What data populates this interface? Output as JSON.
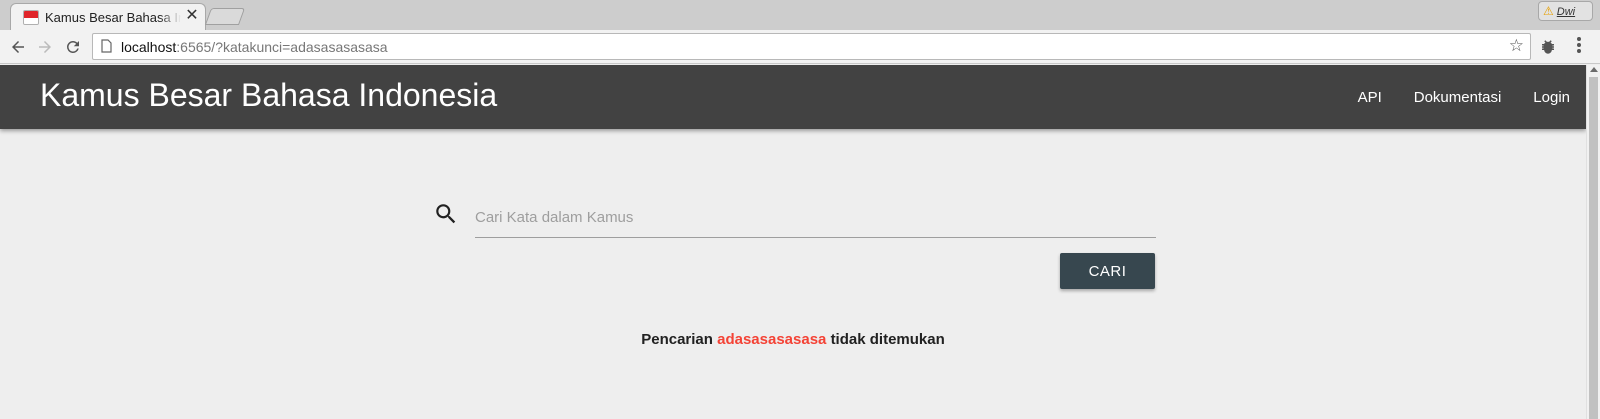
{
  "browser": {
    "tab_title": "Kamus Besar Bahasa Indonesia",
    "tab_close": "✕",
    "profile_name": "Dwi",
    "url_host": "localhost",
    "url_rest": ":6565/?katakunci=adasasasasasa"
  },
  "header": {
    "brand": "Kamus Besar Bahasa Indonesia",
    "nav": {
      "api": "API",
      "docs": "Dokumentasi",
      "login": "Login"
    }
  },
  "search": {
    "placeholder": "Cari Kata dalam Kamus",
    "value": "",
    "button_label": "CARI"
  },
  "result": {
    "prefix": "Pencarian",
    "keyword": "adasasasasasa",
    "suffix": "tidak ditemukan"
  },
  "colors": {
    "appbar": "#424242",
    "button": "#37474f",
    "keyword": "#f44336",
    "background": "#eeeeee"
  },
  "icons": {
    "tab_favicon": "indonesia-flag-icon",
    "back": "arrow-back-icon",
    "forward": "arrow-forward-icon",
    "reload": "reload-icon",
    "page": "page-icon",
    "bookmark": "star-icon",
    "extension": "bug-icon",
    "menu": "more-vert-icon",
    "search": "search-icon",
    "warning": "warning-icon"
  }
}
